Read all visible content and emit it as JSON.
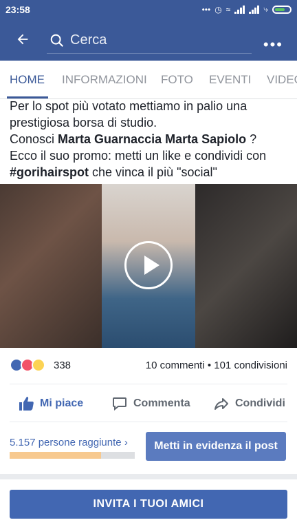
{
  "status_bar": {
    "time": "23:58"
  },
  "header": {
    "search_placeholder": "Cerca",
    "more_label": "•••"
  },
  "tabs": [
    {
      "label": "HOME"
    },
    {
      "label": "INFORMAZIONI"
    },
    {
      "label": "FOTO"
    },
    {
      "label": "EVENTI"
    },
    {
      "label": "VIDEO"
    }
  ],
  "post": {
    "line1": "Per lo spot più votato mettiamo in palio una prestigiosa borsa di studio.",
    "line2_prefix": "Conosci ",
    "mention": "Marta Guarnaccia Marta Sapiolo",
    "line2_suffix": " ?",
    "line3": "Ecco il suo promo: metti un like e condividi con ",
    "hashtag": "#gorihairspot",
    "line3_suffix": " che vinca il più \"social\""
  },
  "reactions": {
    "count": "338",
    "stats": "10 commenti • 101 condivisioni"
  },
  "actions": {
    "like": "Mi piace",
    "comment": "Commenta",
    "share": "Condividi"
  },
  "reach": {
    "label": "5.157 persone raggiunte",
    "progress": 0.73
  },
  "boost_label": "Metti in evidenza il post",
  "invite_label": "INVITA I TUOI AMICI",
  "colors": {
    "header": "#3b5998",
    "accent": "#4267b2",
    "boost": "#5b7bbf",
    "reach_bar": "#f7c98f"
  }
}
